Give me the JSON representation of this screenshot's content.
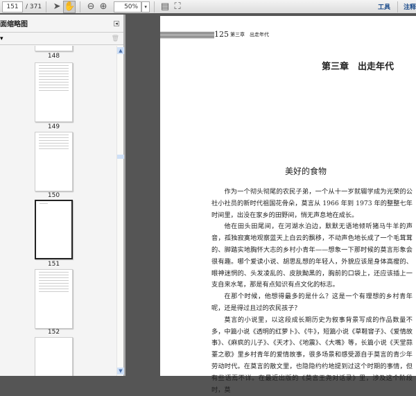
{
  "toolbar": {
    "page_current": "151",
    "page_total": "/ 371",
    "zoom": "50%",
    "tools_label": "工具",
    "comment_label": "注释"
  },
  "sidebar": {
    "title": "页面缩略图",
    "thumbnails": [
      {
        "label": "148"
      },
      {
        "label": "149"
      },
      {
        "label": "150"
      },
      {
        "label": "151",
        "selected": true
      },
      {
        "label": "152"
      }
    ]
  },
  "document": {
    "running_header_page": "125",
    "running_header_text": "第三章　出走年代",
    "chapter_title": "第三章　出走年代",
    "section_title": "美好的食物",
    "paragraphs": [
      "作为一个彻头彻尾的农民子弟，一个从十一岁就辍学成为光荣的公社小社员的新时代祖国花骨朵，莫言从 1966 年到 1973 年的整整七年时间里，出没在家乡的田野间，悄无声息地在成长。",
      "他在田头田尾间，在河湖水泊边，默默无语地倾听猪马牛羊的声音，孤独寂寞地观察蓝天上白云的飘移，不动声色地长成了一个毛茸茸的、脚踏实地胸怀大志的乡村小青年——想象一下那时候的莫言形象会很有趣。哪个爱读小说、胡思乱想的年轻人，外貌应该是身体高瘦的、眼神迷惘的、头发凌乱的、皮肤黝黑的，胸前的口袋上，还应该插上一支自来水笔，那是有点知识有点文化的标志。",
      "在那个时候，他想得最多的是什么？这是一个有理想的乡村青年呢，还是得过且过的农民孩子？",
      "莫言的小说里，以这段成长期历史为叙事背景写成的作品数量不多，中篇小说《透明的红萝卜》、《牛》，短篇小说《草鞋窨子》、《爱情故事》、《麻疯的儿子》、《天才》、《地震》、《大嘴》等，长篇小说《天堂蒜薹之歌》里乡村青年的爱情故事，很多场景和感受源自于莫言的青少年劳动时代。在莫言的散文里，也隐隐约约地提到过这个时期的事情，但有些语焉不详。在最近出版的《莫言王尧对话录》里，涉及这个阶段时，莫"
    ]
  }
}
